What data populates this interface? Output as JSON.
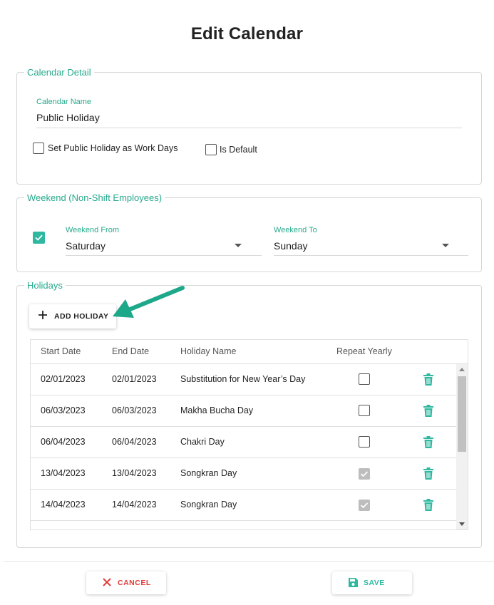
{
  "page": {
    "title": "Edit Calendar"
  },
  "calendar_detail": {
    "legend": "Calendar Detail",
    "name_label": "Calendar Name",
    "name_value": "Public Holiday",
    "set_public_holiday_label": "Set Public Holiday as Work Days",
    "set_public_holiday_checked": false,
    "is_default_label": "Is Default",
    "is_default_checked": false
  },
  "weekend": {
    "legend": "Weekend (Non-Shift Employees)",
    "enabled": true,
    "from_label": "Weekend From",
    "from_value": "Saturday",
    "to_label": "Weekend To",
    "to_value": "Sunday"
  },
  "holidays": {
    "legend": "Holidays",
    "add_button_label": "ADD HOLIDAY",
    "columns": [
      "Start Date",
      "End Date",
      "Holiday Name",
      "Repeat Yearly"
    ],
    "rows": [
      {
        "start": "02/01/2023",
        "end": "02/01/2023",
        "name": "Substitution for New Year’s Day",
        "repeat_yearly": false
      },
      {
        "start": "06/03/2023",
        "end": "06/03/2023",
        "name": "Makha Bucha Day",
        "repeat_yearly": false
      },
      {
        "start": "06/04/2023",
        "end": "06/04/2023",
        "name": "Chakri Day",
        "repeat_yearly": false
      },
      {
        "start": "13/04/2023",
        "end": "13/04/2023",
        "name": "Songkran Day",
        "repeat_yearly": true
      },
      {
        "start": "14/04/2023",
        "end": "14/04/2023",
        "name": "Songkran Day",
        "repeat_yearly": true
      }
    ]
  },
  "footer": {
    "cancel_label": "CANCEL",
    "save_label": "SAVE"
  },
  "icons": {
    "add": "plus-icon",
    "delete": "trash-icon",
    "cancel": "close-icon",
    "save": "floppy-disk-icon",
    "annotation": "arrow-icon"
  },
  "colors": {
    "accent": "#26a98c",
    "checkbox_checked": "#2fb8a0",
    "cancel": "#e33b3b",
    "arrow": "#1ea88a"
  }
}
